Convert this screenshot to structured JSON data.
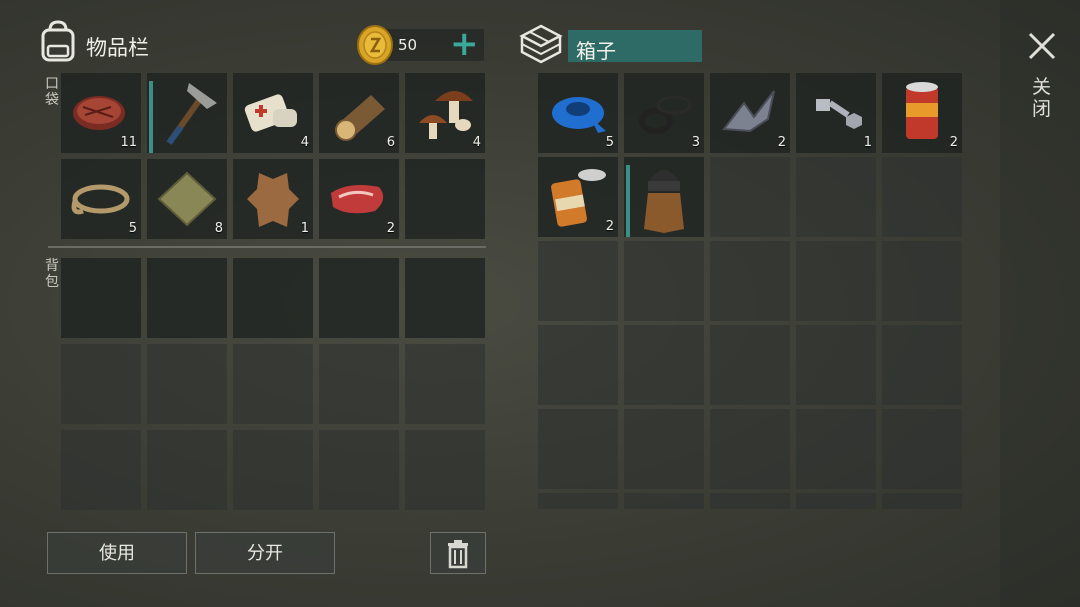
{
  "inventory": {
    "title": "物品栏",
    "pocket_label": "口袋",
    "backpack_label": "背包",
    "coins": "50",
    "add_symbol": "+",
    "pocket_items": [
      {
        "name": "steak-icon",
        "qty": "11"
      },
      {
        "name": "pickaxe-icon",
        "qty": ""
      },
      {
        "name": "bandage-icon",
        "qty": "4"
      },
      {
        "name": "log-icon",
        "qty": "6"
      },
      {
        "name": "mushroom-icon",
        "qty": "4"
      },
      {
        "name": "rope-icon",
        "qty": "5"
      },
      {
        "name": "cloth-icon",
        "qty": "8"
      },
      {
        "name": "leather-icon",
        "qty": "1"
      },
      {
        "name": "raw-meat-icon",
        "qty": "2"
      }
    ]
  },
  "box": {
    "title": "箱子",
    "items": [
      {
        "name": "duct-tape-icon",
        "qty": "5"
      },
      {
        "name": "rubber-rings-icon",
        "qty": "3"
      },
      {
        "name": "metal-scrap-icon",
        "qty": "2"
      },
      {
        "name": "bolt-nut-icon",
        "qty": "1"
      },
      {
        "name": "canned-food-icon",
        "qty": "2"
      },
      {
        "name": "open-can-icon",
        "qty": "2"
      },
      {
        "name": "beanie-scarf-icon",
        "qty": ""
      }
    ]
  },
  "actions": {
    "use_label": "使用",
    "split_label": "分开"
  },
  "close_label": "关闭",
  "colors": {
    "accent": "#3b8f86",
    "title_field": "#2f6b66"
  }
}
